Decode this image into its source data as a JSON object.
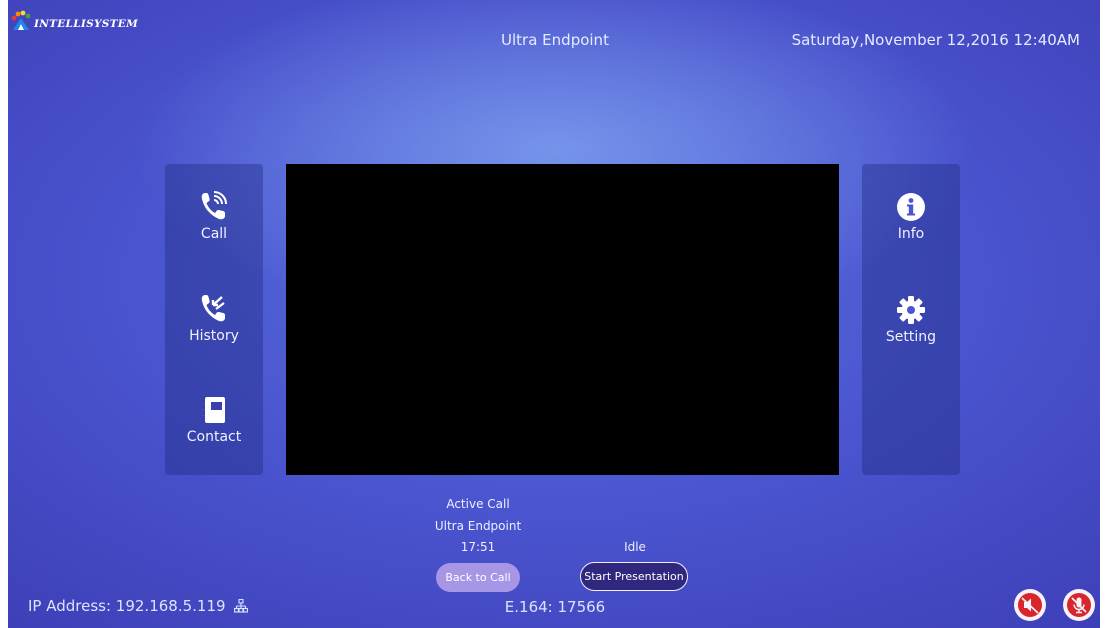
{
  "header": {
    "logo_text": "INTELLISYSTEM",
    "title": "Ultra Endpoint",
    "datetime": "Saturday,November 12,2016 12:40AM"
  },
  "left_nav": [
    {
      "label": "Call",
      "icon": "phone-call-icon"
    },
    {
      "label": "History",
      "icon": "call-history-icon"
    },
    {
      "label": "Contact",
      "icon": "contact-book-icon"
    }
  ],
  "right_nav": [
    {
      "label": "Info",
      "icon": "info-icon"
    },
    {
      "label": "Setting",
      "icon": "gear-icon"
    }
  ],
  "call": {
    "state": "Active Call",
    "remote_name": "Ultra Endpoint",
    "duration": "17:51",
    "presentation_state": "Idle",
    "back_label": "Back to Call",
    "present_label": "Start Presentation"
  },
  "footer": {
    "ip_address": "IP Address: 192.168.5.119",
    "e164": "E.164: 17566"
  },
  "colors": {
    "background": "#4a55cf",
    "back_button": "#a796e6",
    "present_button": "#30277e",
    "mute_red": "#d8262c"
  }
}
